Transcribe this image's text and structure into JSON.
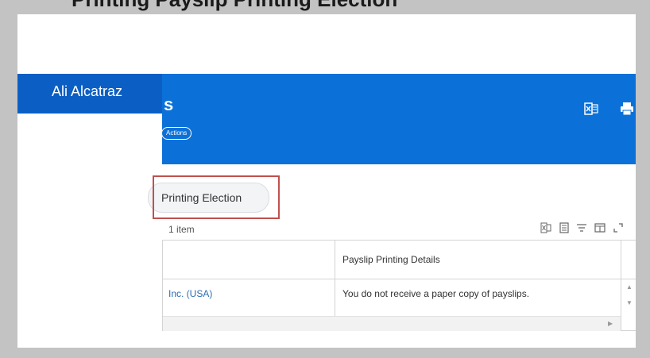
{
  "top_title": "Printing Payslip Printing Election",
  "user": {
    "name": "Ali Alcatraz"
  },
  "banner": {
    "title": "s",
    "actions_label": "Actions"
  },
  "content": {
    "election_button_label": "Printing Election",
    "item_count": "1 item"
  },
  "table": {
    "header": "Payslip Printing Details",
    "rows": [
      {
        "company": "Inc. (USA)",
        "details": "You do not receive a paper copy of payslips."
      }
    ]
  },
  "icons": [
    "excel-icon",
    "print-icon",
    "excel-export-icon",
    "table-view-icon",
    "filter-icon",
    "columns-icon",
    "fullscreen-icon"
  ]
}
